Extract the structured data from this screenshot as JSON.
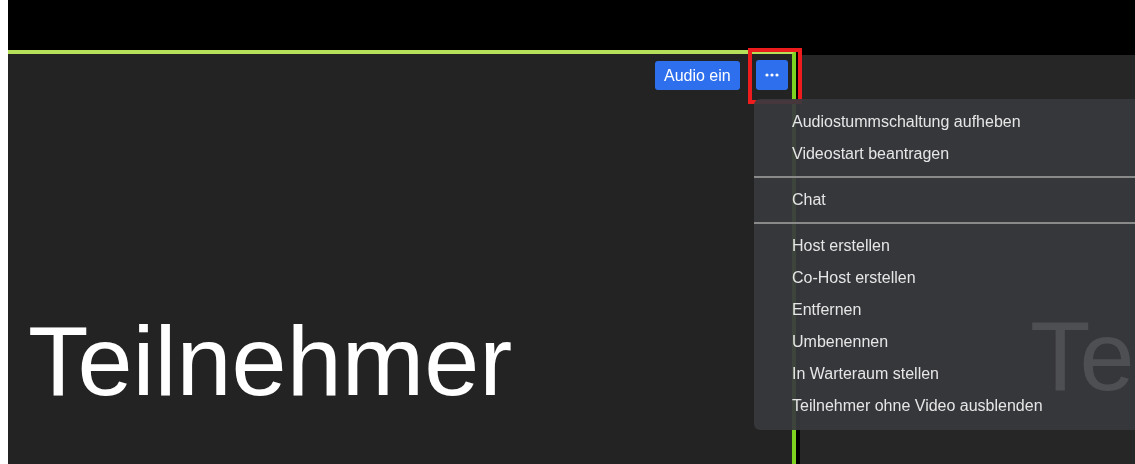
{
  "tiles": [
    {
      "name": "Teilnehmer",
      "speaking": true
    },
    {
      "name": "Te",
      "speaking": false
    }
  ],
  "audio_button": {
    "label": "Audio ein"
  },
  "more_button": {
    "highlighted": true
  },
  "menu": {
    "groups": [
      [
        "Audiostummschaltung aufheben",
        "Videostart beantragen"
      ],
      [
        "Chat"
      ],
      [
        "Host erstellen",
        "Co-Host erstellen",
        "Entfernen",
        "Umbenennen",
        "In Warteraum stellen",
        "Teilnehmer ohne Video ausblenden"
      ]
    ]
  }
}
